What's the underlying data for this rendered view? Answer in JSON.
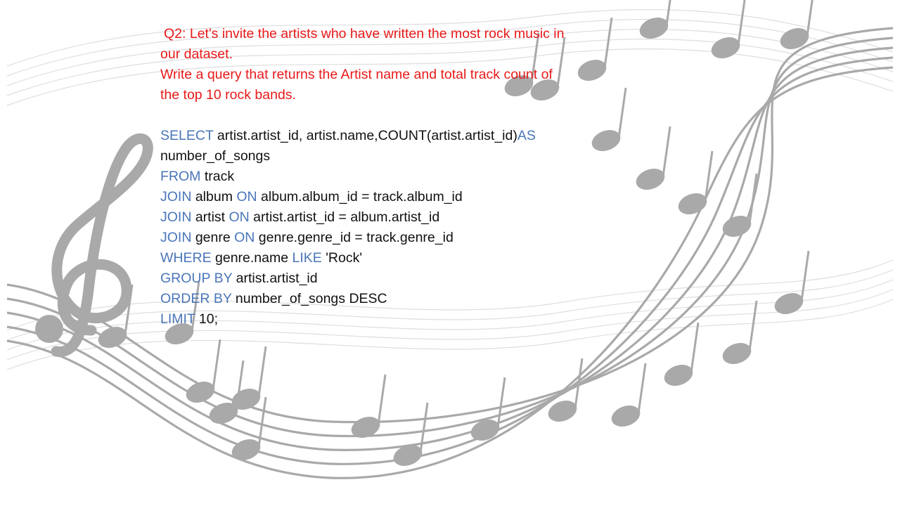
{
  "colors": {
    "question": "#e81a1a",
    "keyword": "#4a76b8",
    "plain": "#111111",
    "staff": "#a9a9a9",
    "staff_light": "#dedede"
  },
  "question": {
    "lines": [
      "Q2: Let's invite the artists who have written the most rock music in",
      "our dataset.",
      "Write a query that returns the Artist name and total track count of",
      "the top 10 rock bands."
    ]
  },
  "code": {
    "l1": {
      "k1": "SELECT",
      "t1": " artist.artist_id, artist.name,COUNT(artist.artist_id)",
      "k2": "AS"
    },
    "l2": {
      "t1": "number_of_songs"
    },
    "l3": {
      "k1": "FROM",
      "t1": " track"
    },
    "l4": {
      "k1": "JOIN",
      "t1": " album ",
      "k2": "ON",
      "t2": " album.album_id = track.album_id"
    },
    "l5": {
      "k1": "JOIN",
      "t1": " artist ",
      "k2": "ON",
      "t2": " artist.artist_id = album.artist_id"
    },
    "l6": {
      "k1": "JOIN",
      "t1": " genre ",
      "k2": "ON",
      "t2": " genre.genre_id = track.genre_id"
    },
    "l7": {
      "k1": "WHERE",
      "t1": " genre.name ",
      "k2": "LIKE",
      "t2": " 'Rock'"
    },
    "l8": {
      "k1": "GROUP BY",
      "t1": " artist.artist_id"
    },
    "l9": {
      "k1": "ORDER BY",
      "t1": " number_of_songs DESC"
    },
    "l10": {
      "k1": "LIMIT",
      "t1": " 10;"
    }
  }
}
